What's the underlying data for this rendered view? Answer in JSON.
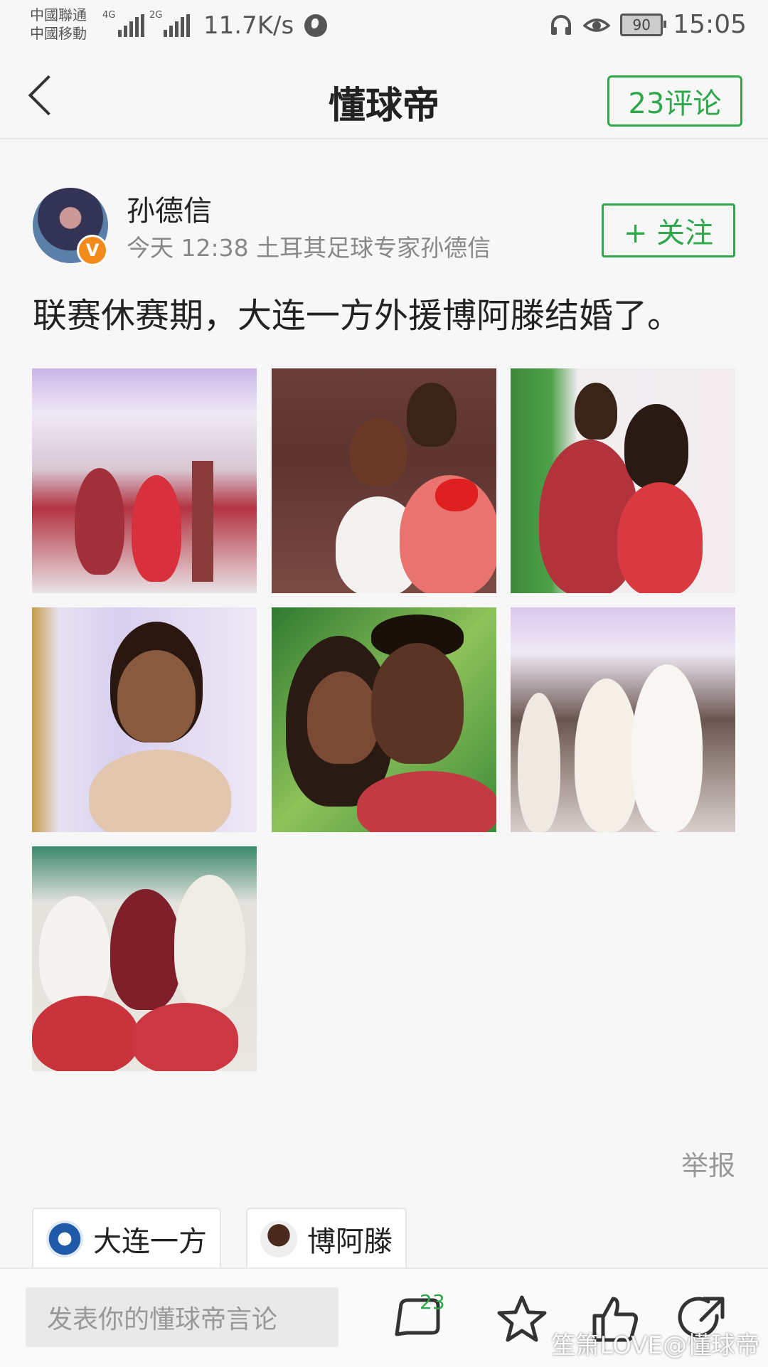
{
  "status_bar": {
    "carrier1": "中國聯通",
    "carrier2": "中國移動",
    "net1": "4G",
    "net2": "2G",
    "speed": "11.7K/s",
    "battery": "90",
    "time": "15:05"
  },
  "header": {
    "title": "懂球帝",
    "comments_button": "23评论"
  },
  "author": {
    "name": "孙德信",
    "meta": "今天 12:38  土耳其足球专家孙德信",
    "verified_badge": "V",
    "follow_label": "+ 关注"
  },
  "post": {
    "text": "联赛休赛期，大连一方外援博阿滕结婚了。",
    "photos": [
      "wedding-hall",
      "couple-selfie",
      "couple-backdrop",
      "bride-portrait",
      "couple-closeup",
      "groom-dancing",
      "groomsmen-group"
    ]
  },
  "report_label": "举报",
  "tags": [
    {
      "label": "大连一方",
      "icon": "club-crest-icon"
    },
    {
      "label": "博阿滕",
      "icon": "player-avatar-icon"
    }
  ],
  "bottom_bar": {
    "comment_placeholder": "发表你的懂球帝言论",
    "comment_count": "23"
  },
  "watermark": "笙箫LOVE@懂球帝",
  "colors": {
    "accent_green": "#2ea84a",
    "verified_orange": "#f28a1c",
    "background": "#f7f7f7"
  }
}
